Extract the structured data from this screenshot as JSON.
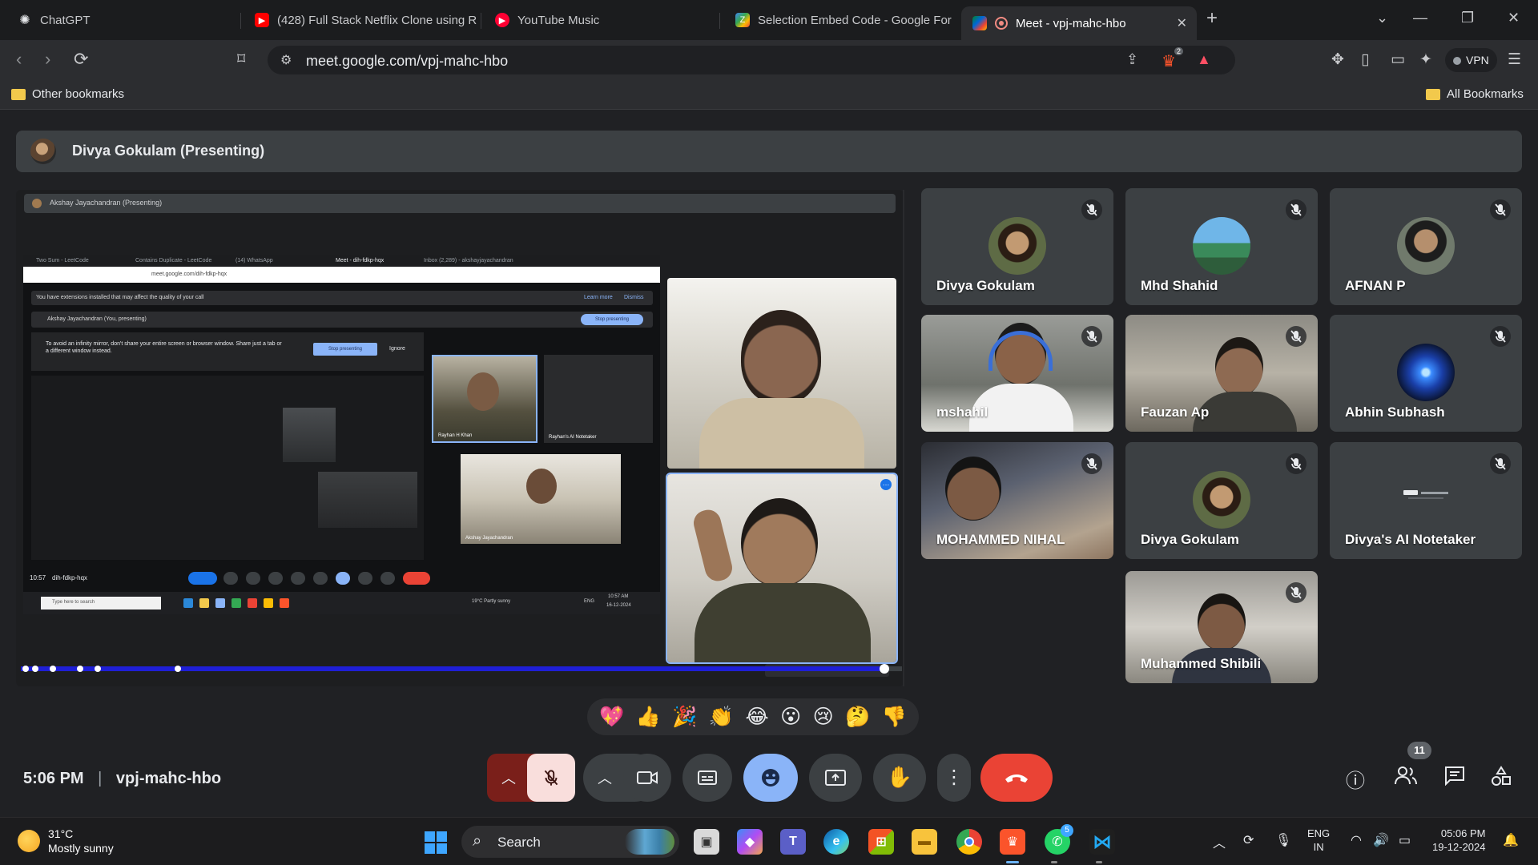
{
  "browser": {
    "tabs": [
      {
        "title": "ChatGPT",
        "favicon": "chatgpt-icon"
      },
      {
        "title": "(428) Full Stack Netflix Clone using R",
        "favicon": "youtube-icon"
      },
      {
        "title": "YouTube Music",
        "favicon": "youtube-music-icon"
      },
      {
        "title": "Selection Embed Code - Google For",
        "favicon": "google-forms-icon"
      },
      {
        "title": "Meet - vpj-mahc-hbo",
        "favicon": "google-meet-icon",
        "active": true
      }
    ],
    "url": "meet.google.com/vpj-mahc-hbo",
    "vpn_label": "VPN",
    "brave_badge": "2",
    "bookmarks": {
      "left": "Other bookmarks",
      "right": "All Bookmarks"
    }
  },
  "meet": {
    "presenter_banner": "Divya Gokulam (Presenting)",
    "shared_screen": {
      "inner_banner": "Akshay Jayachandran (Presenting)",
      "tabs": [
        "Two Sum - LeetCode",
        "Contains Duplicate - LeetCode",
        "(14) WhatsApp",
        "Meet - dih-fdkp-hqx",
        "Inbox (2,289) - akshayjayachandran"
      ],
      "url": "meet.google.com/dih-fdkp-hqx",
      "notice": "You have extensions installed that may affect the quality of your call",
      "notice_learn": "Learn more",
      "notice_dismiss": "Dismiss",
      "presenting_label": "Akshay Jayachandran (You, presenting)",
      "stop_presenting": "Stop presenting",
      "warning": "To avoid an infinity mirror, don't share your entire screen or browser window. Share just a tab or a different window instead.",
      "warning_stop": "Stop presenting",
      "warning_ignore": "Ignore",
      "cam_labels": [
        "Rayhan H Khan",
        "Rayhan's AI Notetaker",
        "Akshay Jayachandran"
      ],
      "meeting_time": "10:57",
      "meeting_code": "dih-fdkp-hqx",
      "taskbar_search": "Type here to search",
      "weather": "19°C  Partly sunny",
      "tray_lang": "ENG",
      "tray_time": "10:57 AM",
      "tray_date": "16-12-2024"
    },
    "progress": 0.98,
    "participants": [
      {
        "name": "Divya Gokulam",
        "type": "avatar"
      },
      {
        "name": "Mhd Shahid",
        "type": "avatar"
      },
      {
        "name": "AFNAN P",
        "type": "avatar"
      },
      {
        "name": "mshahil",
        "type": "video"
      },
      {
        "name": "Fauzan Ap",
        "type": "video"
      },
      {
        "name": "Abhin Subhash",
        "type": "avatar"
      },
      {
        "name": "MOHAMMED NIHAL",
        "type": "video"
      },
      {
        "name": "Divya Gokulam",
        "type": "avatar"
      },
      {
        "name": "Divya's AI Notetaker",
        "type": "logo"
      },
      {
        "name": "Muhammed Shibili",
        "type": "video"
      }
    ],
    "reactions": [
      "💖",
      "👍",
      "🎉",
      "👏",
      "😂",
      "😮",
      "😢",
      "🤔",
      "👎"
    ],
    "time": "5:06 PM",
    "separator": "|",
    "meeting_code": "vpj-mahc-hbo",
    "participant_count": "11",
    "controls": [
      "chevron-up-icon",
      "mic-off-icon",
      "chevron-up-icon",
      "camera-icon",
      "captions-icon",
      "emoji-icon",
      "present-icon",
      "raise-hand-icon",
      "more-icon",
      "end-call-icon"
    ],
    "colors": {
      "end_call": "#ea4335",
      "mic_off_bg": "#f9dedc",
      "active_control": "#8ab4f8"
    }
  },
  "taskbar": {
    "weather_temp": "31°C",
    "weather_desc": "Mostly sunny",
    "search_label": "Search",
    "lang_top": "ENG",
    "lang_bottom": "IN",
    "time": "05:06 PM",
    "date": "19-12-2024",
    "whatsapp_badge": "5"
  }
}
